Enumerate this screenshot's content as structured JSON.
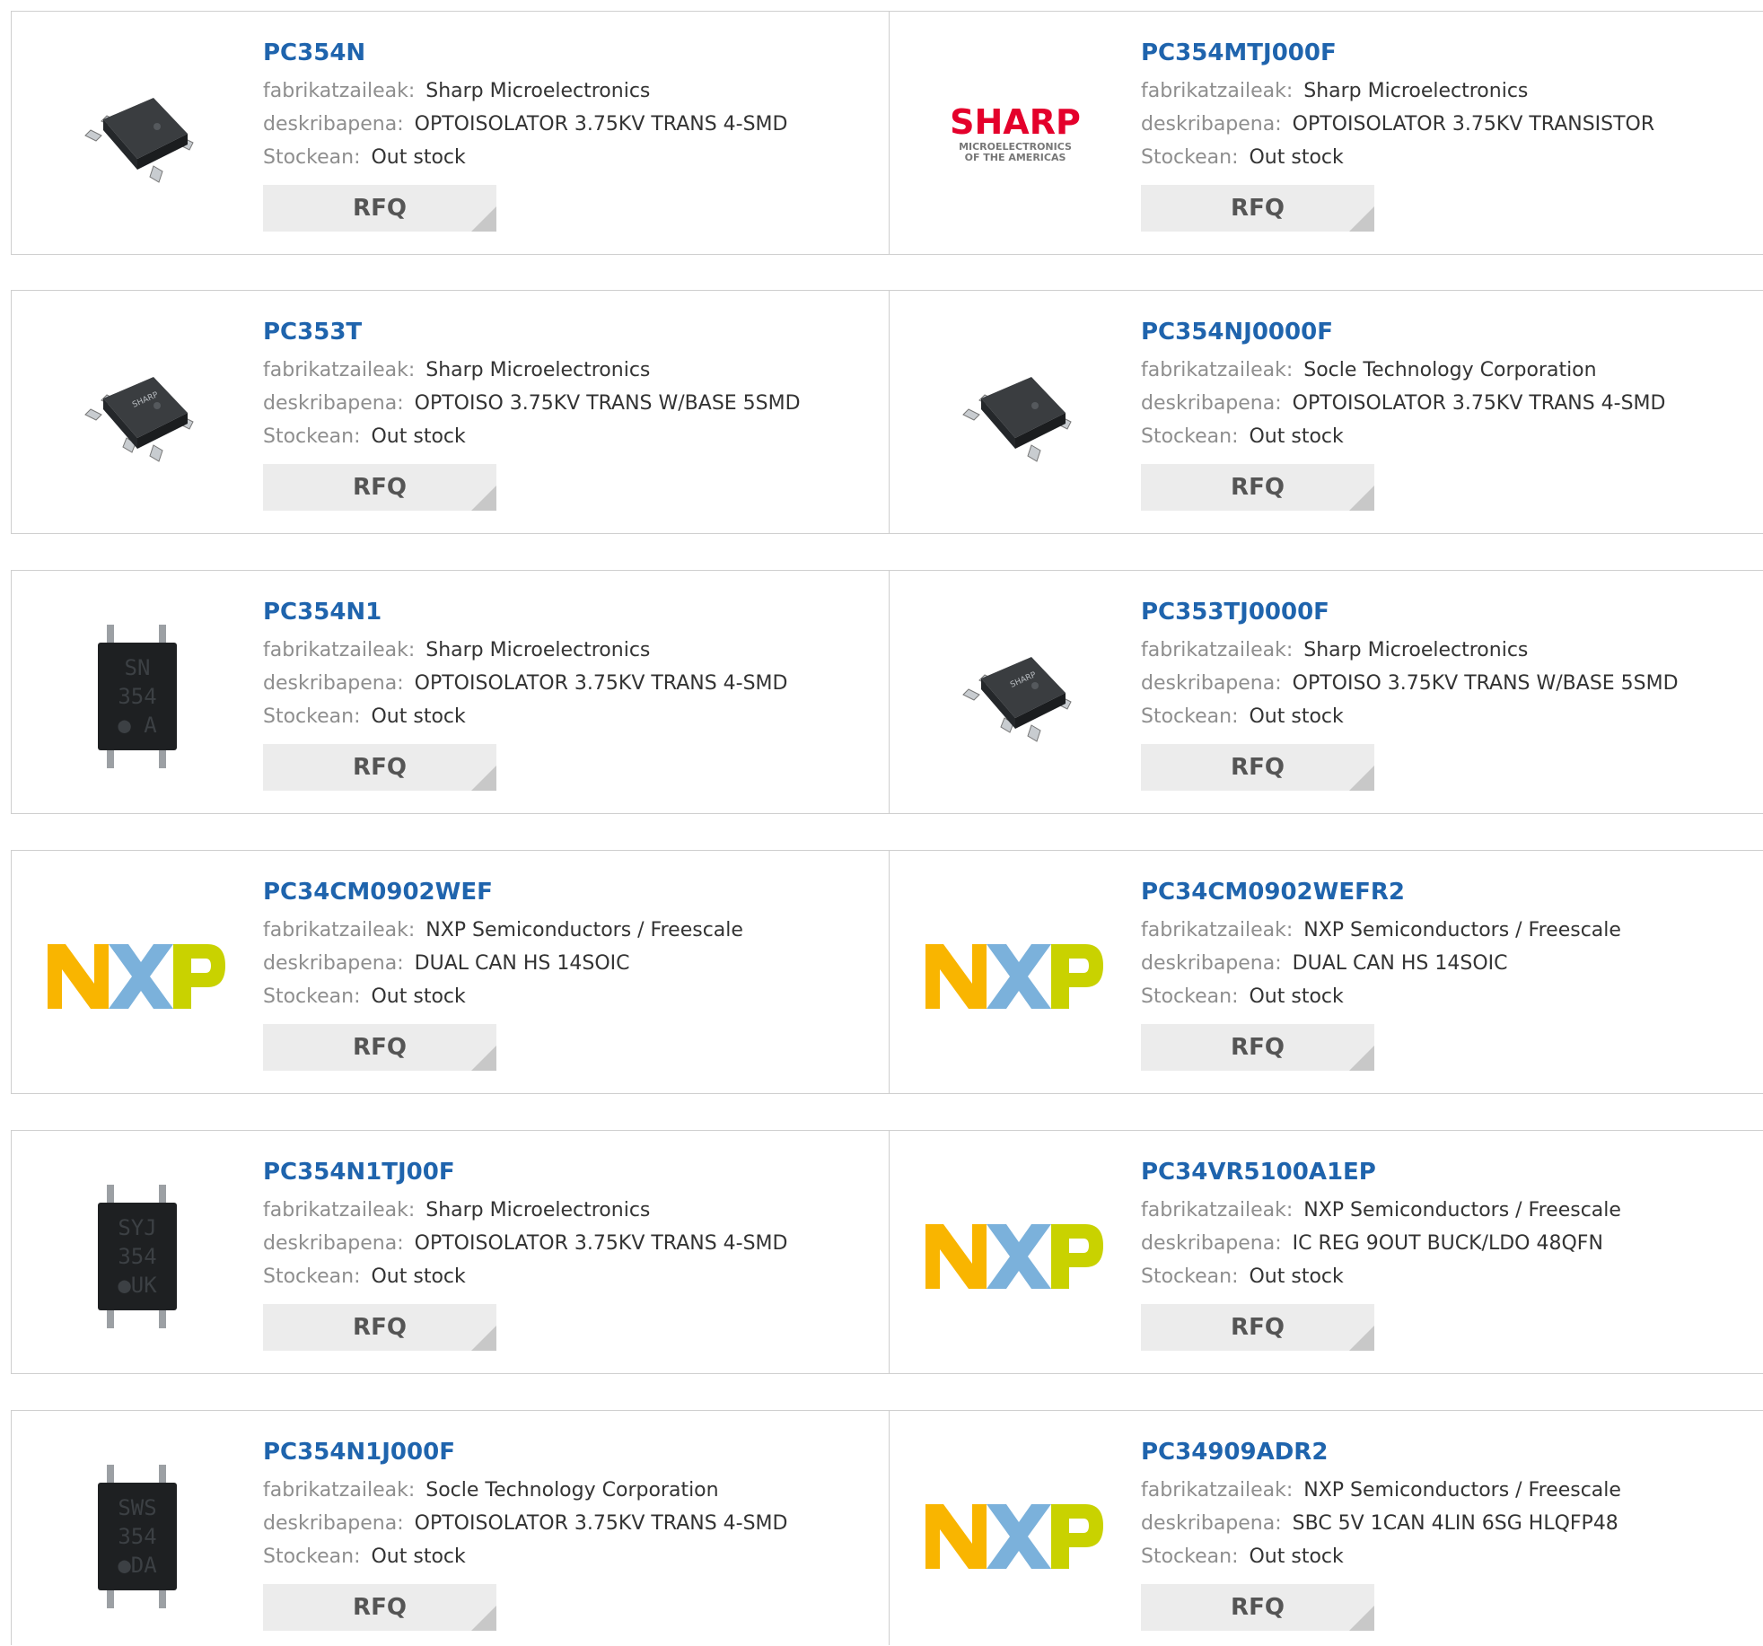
{
  "labels": {
    "manufacturer": "fabrikatzaileak:",
    "description": "deskribapena:",
    "stock": "Stockean:",
    "rfq": "RFQ"
  },
  "colors": {
    "link": "#1f64ad",
    "border": "#cfcfcf",
    "button_bg": "#ececec",
    "sharp_red": "#e4002b",
    "nxp_orange": "#f9b500",
    "nxp_blue": "#7bb1db",
    "nxp_green": "#c9d200"
  },
  "rows": [
    {
      "left": {
        "part": "PC354N",
        "manufacturer": "Sharp Microelectronics",
        "description": "OPTOISOLATOR 3.75KV TRANS 4-SMD",
        "stock": "Out stock",
        "image": "smd-4pin-chip"
      },
      "right": {
        "part": "PC354MTJ000F",
        "manufacturer": "Sharp Microelectronics",
        "description": "OPTOISOLATOR 3.75KV TRANSISTOR",
        "stock": "Out stock",
        "image": "sharp-logo",
        "logo_text": "SHARP",
        "logo_sub1": "MICROELECTRONICS",
        "logo_sub2": "OF THE AMERICAS"
      }
    },
    {
      "left": {
        "part": "PC353T",
        "manufacturer": "Sharp Microelectronics",
        "description": "OPTOISO 3.75KV TRANS W/BASE 5SMD",
        "stock": "Out stock",
        "image": "smd-5pin-chip",
        "chip_mark": "SHARP"
      },
      "right": {
        "part": "PC354NJ0000F",
        "manufacturer": "Socle Technology Corporation",
        "description": "OPTOISOLATOR 3.75KV TRANS 4-SMD",
        "stock": "Out stock",
        "image": "smd-4pin-chip"
      }
    },
    {
      "left": {
        "part": "PC354N1",
        "manufacturer": "Sharp Microelectronics",
        "description": "OPTOISOLATOR 3.75KV TRANS 4-SMD",
        "stock": "Out stock",
        "image": "top-view-chip",
        "chip_mark": [
          "SN",
          "354",
          "● A"
        ]
      },
      "right": {
        "part": "PC353TJ0000F",
        "manufacturer": "Sharp Microelectronics",
        "description": "OPTOISO 3.75KV TRANS W/BASE 5SMD",
        "stock": "Out stock",
        "image": "smd-5pin-chip",
        "chip_mark": "SHARP"
      }
    },
    {
      "left": {
        "part": "PC34CM0902WEF",
        "manufacturer": "NXP Semiconductors / Freescale",
        "description": "DUAL CAN HS 14SOIC",
        "stock": "Out stock",
        "image": "nxp-logo"
      },
      "right": {
        "part": "PC34CM0902WEFR2",
        "manufacturer": "NXP Semiconductors / Freescale",
        "description": "DUAL CAN HS 14SOIC",
        "stock": "Out stock",
        "image": "nxp-logo"
      }
    },
    {
      "left": {
        "part": "PC354N1TJ00F",
        "manufacturer": "Sharp Microelectronics",
        "description": "OPTOISOLATOR 3.75KV TRANS 4-SMD",
        "stock": "Out stock",
        "image": "top-view-chip",
        "chip_mark": [
          "SYJ",
          "354",
          "●UK"
        ]
      },
      "right": {
        "part": "PC34VR5100A1EP",
        "manufacturer": "NXP Semiconductors / Freescale",
        "description": "IC REG 9OUT BUCK/LDO 48QFN",
        "stock": "Out stock",
        "image": "nxp-logo"
      }
    },
    {
      "left": {
        "part": "PC354N1J000F",
        "manufacturer": "Socle Technology Corporation",
        "description": "OPTOISOLATOR 3.75KV TRANS 4-SMD",
        "stock": "Out stock",
        "image": "top-view-chip",
        "chip_mark": [
          "SWS",
          "354",
          "●DA"
        ]
      },
      "right": {
        "part": "PC34909ADR2",
        "manufacturer": "NXP Semiconductors / Freescale",
        "description": "SBC 5V 1CAN 4LIN 6SG HLQFP48",
        "stock": "Out stock",
        "image": "nxp-logo"
      }
    }
  ]
}
